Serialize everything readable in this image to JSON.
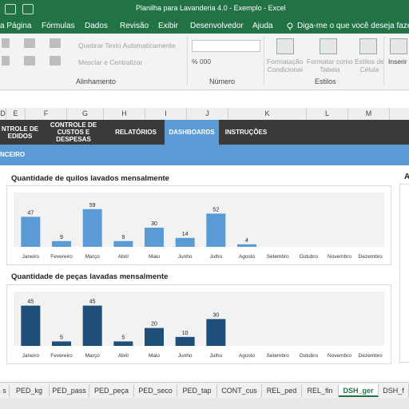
{
  "title": "Planilha para Lavanderia 4.0 - Exemplo  -  Excel",
  "ribbon_tabs": [
    "a Página",
    "Fórmulas",
    "Dados",
    "Revisão",
    "Exibir",
    "Desenvolvedor",
    "Ajuda"
  ],
  "search_text": "Diga-me o que você deseja fazer",
  "ribbon": {
    "wrap_text": "Quebrar Texto Automaticamente",
    "merge_center": "Mesclar e Centralizar",
    "number_symbols": "% 000",
    "cond_format": "Formatação\nCondicional",
    "format_table": "Formatar como\nTabela",
    "cell_styles": "Estilos de\nCélula",
    "insert": "Inserir",
    "groups": [
      "Alinhamento",
      "Número",
      "Estilos"
    ]
  },
  "columns": [
    "D",
    "E",
    "F",
    "G",
    "H",
    "I",
    "J",
    "K",
    "L",
    "M"
  ],
  "nav": [
    {
      "label": "NTROLE DE\nEDIDOS",
      "active": false
    },
    {
      "label": "CONTROLE DE\nCUSTOS E DESPESAS",
      "active": false
    },
    {
      "label": "RELATÓRIOS",
      "active": false
    },
    {
      "label": "DASHBOARDS",
      "active": true
    },
    {
      "label": "INSTRUÇÕES",
      "active": false
    }
  ],
  "subbar_label": "NCEIRO",
  "right_panel_letter": "A",
  "chart_data": [
    {
      "type": "bar",
      "title": "Quantidade de quilos lavados mensalmente",
      "categories": [
        "Janeiro",
        "Fevereiro",
        "Março",
        "Abril",
        "Maio",
        "Junho",
        "Julho",
        "Agosto",
        "Setembro",
        "Outubro",
        "Novembro",
        "Dezembro"
      ],
      "values": [
        47,
        9,
        59,
        9,
        30,
        14,
        52,
        4,
        null,
        null,
        null,
        null
      ],
      "color": "#5b9bd5",
      "ylim": [
        0,
        70
      ],
      "grid": false
    },
    {
      "type": "bar",
      "title": "Quantidade de peças lavadas mensalmente",
      "categories": [
        "Janeiro",
        "Fevereiro",
        "Março",
        "Abril",
        "Maio",
        "Junho",
        "Julho",
        "Agosto",
        "Setembro",
        "Outubro",
        "Novembro",
        "Dezembro"
      ],
      "values": [
        45,
        5,
        45,
        5,
        20,
        10,
        30,
        null,
        null,
        null,
        null,
        null
      ],
      "color": "#1f4e79",
      "ylim": [
        0,
        50
      ],
      "grid": false
    }
  ],
  "sheet_tabs": [
    {
      "label": "s",
      "active": false
    },
    {
      "label": "PED_kg",
      "active": false
    },
    {
      "label": "PED_pass",
      "active": false
    },
    {
      "label": "PED_peça",
      "active": false
    },
    {
      "label": "PED_seco",
      "active": false
    },
    {
      "label": "PED_tap",
      "active": false
    },
    {
      "label": "CONT_cus",
      "active": false
    },
    {
      "label": "REL_ped",
      "active": false
    },
    {
      "label": "REL_fin",
      "active": false
    },
    {
      "label": "DSH_ger",
      "active": true
    },
    {
      "label": "DSH_f",
      "active": false
    }
  ]
}
